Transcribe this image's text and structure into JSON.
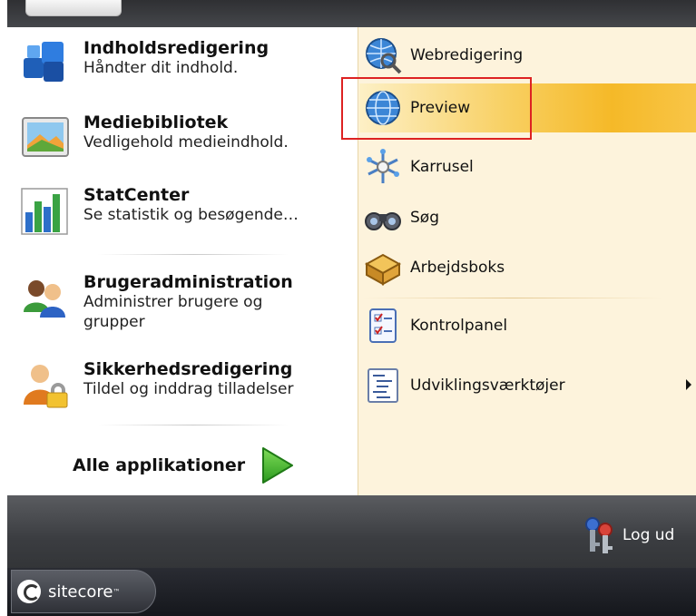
{
  "left_items": [
    {
      "title": "Indholdsredigering",
      "subtitle": "Håndter dit indhold.",
      "icon": "content-editor-icon"
    },
    {
      "title": "Mediebibliotek",
      "subtitle": "Vedligehold medieindhold.",
      "icon": "media-library-icon"
    },
    {
      "title": "StatCenter",
      "subtitle": "Se statistik og besøgende…",
      "icon": "statcenter-icon"
    },
    {
      "title": "Brugeradministration",
      "subtitle": "Administrer brugere og grupper",
      "icon": "user-admin-icon"
    },
    {
      "title": "Sikkerhedsredigering",
      "subtitle": "Tildel og inddrag tilladelser",
      "icon": "security-editor-icon"
    }
  ],
  "all_apps_label": "Alle applikationer",
  "right_items": [
    {
      "label": "Webredigering",
      "icon": "web-edit-icon"
    },
    {
      "label": "Preview",
      "icon": "globe-icon",
      "highlighted": true
    },
    {
      "label": "Karrusel",
      "icon": "carousel-icon"
    },
    {
      "label": "Søg",
      "icon": "binoculars-icon"
    },
    {
      "label": "Arbejdsboks",
      "icon": "workbox-icon"
    },
    {
      "label": "Kontrolpanel",
      "icon": "control-panel-icon"
    },
    {
      "label": "Udviklingsværktøjer",
      "icon": "developer-tools-icon",
      "has_submenu": true
    }
  ],
  "logout_label": "Log ud",
  "start_label": "sitecore",
  "colors": {
    "highlight": "#f5b928",
    "annotation_border": "#dd2222",
    "right_panel_bg": "#fdf3dc"
  }
}
